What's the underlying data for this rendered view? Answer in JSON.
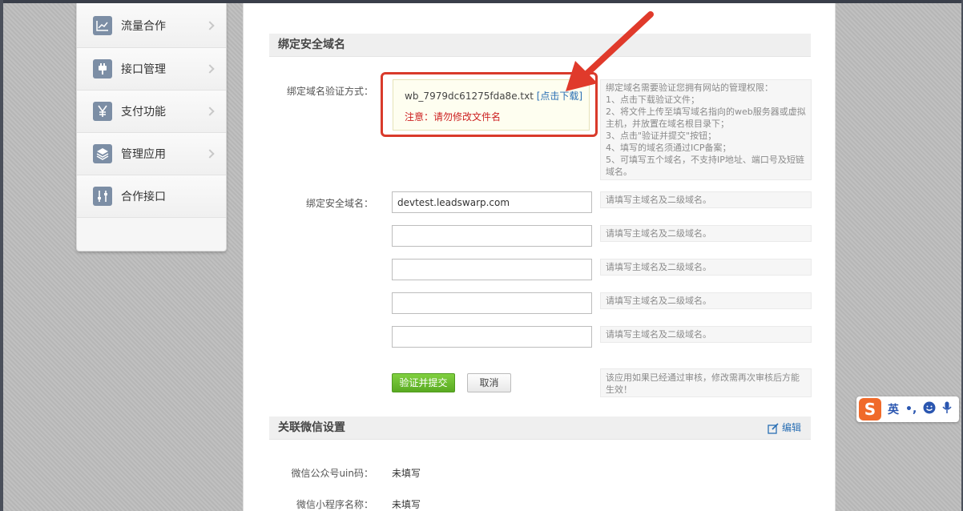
{
  "sidebar": {
    "items": [
      {
        "label": "流量合作",
        "icon": "chart-icon"
      },
      {
        "label": "接口管理",
        "icon": "plug-icon"
      },
      {
        "label": "支付功能",
        "icon": "yen-icon"
      },
      {
        "label": "管理应用",
        "icon": "layers-icon"
      },
      {
        "label": "合作接口",
        "icon": "sliders-icon"
      }
    ]
  },
  "bind_section": {
    "title": "绑定安全域名",
    "verify_label": "绑定域名验证方式：",
    "verify_file": "wb_7979dc61275fda8e.txt",
    "download_link": "[点击下载]",
    "warning": "注意：请勿修改文件名",
    "verify_tip": [
      "绑定域名需要验证您拥有网站的管理权限：",
      "1、点击下载验证文件；",
      "2、将文件上传至填写域名指向的web服务器或虚拟主机，并放置在域名根目录下；",
      "3、点击\"验证并提交\"按钮；",
      "4、填写的域名须通过ICP备案；",
      "5、可填写五个域名，不支持IP地址、端口号及短链域名。"
    ],
    "domain_label": "绑定安全域名：",
    "domains": [
      "devtest.leadswarp.com",
      "",
      "",
      "",
      ""
    ],
    "domain_tip": "请填写主域名及二级域名。",
    "submit_label": "验证并提交",
    "cancel_label": "取消",
    "submit_tip": "该应用如果已经通过审核，修改需再次审核后方能生效！"
  },
  "wechat_section": {
    "title": "关联微信设置",
    "edit_label": "编辑",
    "uin_label": "微信公众号uin码：",
    "uin_value": "未填写",
    "mini_label": "微信小程序名称：",
    "mini_value": "未填写"
  },
  "ime": {
    "logo": "S",
    "lang": "英",
    "punct": "•,"
  },
  "colors": {
    "accent_red": "#d93a2b",
    "link_blue": "#2a6fb4",
    "submit_green": "#5aaa22",
    "warning_red": "#cc1f1f"
  }
}
